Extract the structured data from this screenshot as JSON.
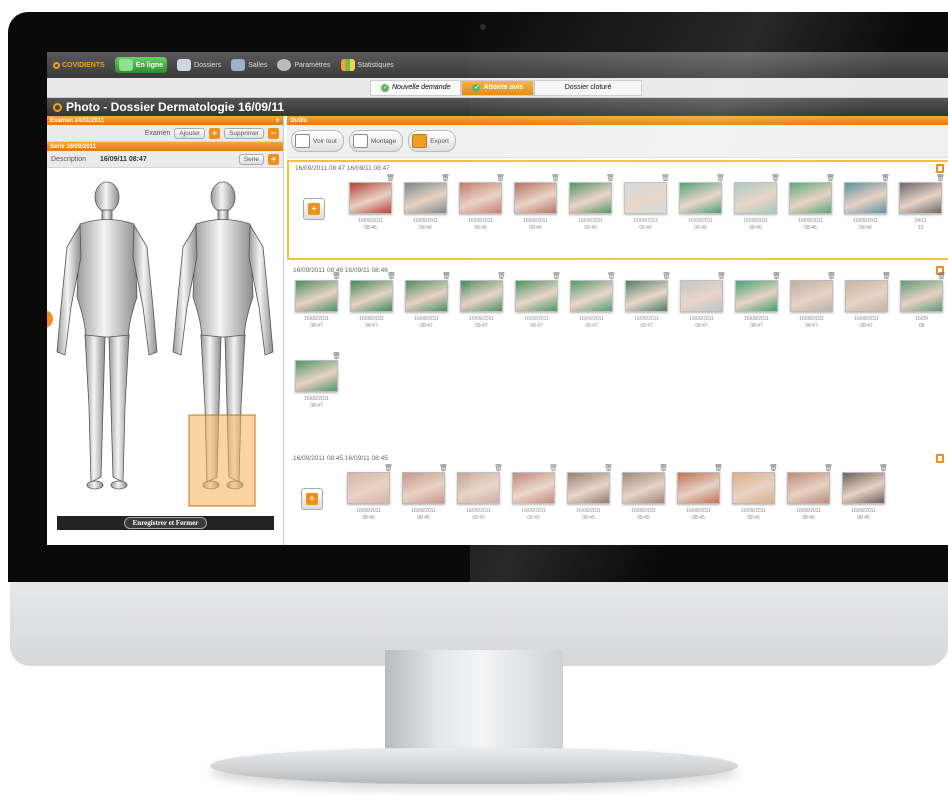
{
  "app": {
    "logo": "COVIDIENTS"
  },
  "nav": [
    {
      "label": "En ligne",
      "icon": "status-icon",
      "active": true
    },
    {
      "label": "Dossiers",
      "icon": "folder-icon",
      "active": false
    },
    {
      "label": "Salles",
      "icon": "rooms-icon",
      "active": false
    },
    {
      "label": "Paramètres",
      "icon": "gear-icon",
      "active": false
    },
    {
      "label": "Statistiques",
      "icon": "chart-icon",
      "active": false
    }
  ],
  "workflow": [
    {
      "label": "Nouvelle demande",
      "state": "done"
    },
    {
      "label": "Attente avis",
      "state": "current"
    },
    {
      "label": "Dossier cloturé",
      "state": "todo"
    }
  ],
  "title": "Photo - Dossier Dermatologie 16/09/11",
  "left": {
    "exam_header": "Examen 24/11/2011",
    "exam_label": "Examen",
    "add_label": "Ajouter",
    "delete_label": "Supprimer",
    "serie_header": "Serie 16/09/2011",
    "desc_label": "Description",
    "desc_value": "16/09/11 08:47",
    "serie_label": "Serie",
    "save_label": "Enregistrer et Fermer"
  },
  "tools": {
    "header": "Outils",
    "view_all": "Voir tout",
    "montage": "Montage",
    "export": "Export"
  },
  "series": [
    {
      "header": "16/09/2011 08:47   16/09/11 08:47",
      "selected": true,
      "captions": [
        "16/09/2011\n08:46",
        "16/09/2011\n08:46",
        "16/09/2011\n08:46",
        "16/09/2011\n08:46",
        "16/09/2011\n08:46",
        "16/09/2011\n08:46",
        "16/09/2011\n08:46",
        "16/09/2011\n08:46",
        "16/09/2011\n08:46",
        "16/09/2011\n08:46",
        "24/11\n12"
      ],
      "colors": [
        "#b8413a",
        "#7a8a8f",
        "#c47a6a",
        "#b26a5a",
        "#4a8a5a",
        "#c9d8de",
        "#3e9468",
        "#a4c6c1",
        "#5aa878",
        "#5e94a0",
        "#6a6a6a"
      ]
    },
    {
      "header": "16/09/2011 08:46   16/09/11 08:46",
      "selected": false,
      "captions": [
        "16/09/2011\n08:47",
        "16/09/2011\n08:47",
        "16/09/2011\n08:47",
        "16/09/2011\n08:47",
        "16/09/2011\n08:47",
        "16/09/2011\n08:47",
        "16/09/2011\n08:47",
        "16/09/2011\n08:47",
        "16/09/2011\n08:47",
        "16/09/2011\n08:47",
        "16/09/2011\n08:47",
        "16/09\n08"
      ],
      "colors": [
        "#4c8f63",
        "#3f8a5d",
        "#4b9062",
        "#468a5e",
        "#3c8c58",
        "#3e9060",
        "#3a6f57",
        "#b9c3c5",
        "#3fa070",
        "#b8b2a8",
        "#c4b4a8",
        "#5e9a78"
      ]
    },
    {
      "header": "",
      "selected": false,
      "captions": [
        "16/09/2011\n08:47"
      ],
      "colors": [
        "#52966a"
      ]
    },
    {
      "header": "16/09/2011 08:45   16/09/11 08:45",
      "selected": false,
      "captions": [
        "16/09/2011\n08:45",
        "16/09/2011\n08:45",
        "16/09/2011\n08:45",
        "16/09/2011\n08:45",
        "16/09/2011\n08:45",
        "16/09/2011\n08:45",
        "16/09/2011\n08:45",
        "16/09/2011\n08:45",
        "16/09/2011\n08:45",
        "16/09/2011\n08:45"
      ],
      "colors": [
        "#d9b3aa",
        "#c99890",
        "#c8a49a",
        "#b87a6a",
        "#8a7068",
        "#9a8078",
        "#c07056",
        "#d8b08a",
        "#bb8a78",
        "#6c6258"
      ]
    }
  ]
}
